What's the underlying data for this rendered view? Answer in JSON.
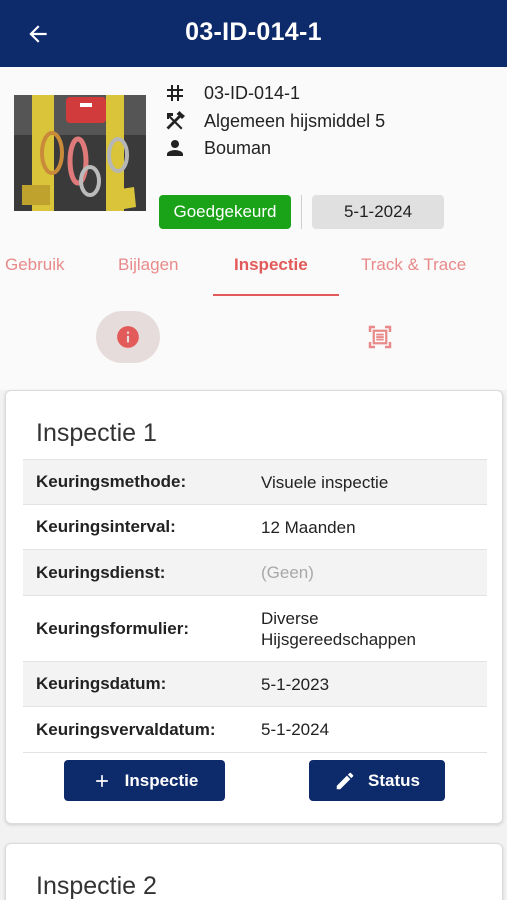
{
  "header": {
    "title": "03-ID-014-1",
    "back_icon": "arrow-left-icon"
  },
  "item": {
    "id": "03-ID-014-1",
    "description": "Algemeen hijsmiddel 5",
    "owner": "Bouman",
    "status": "Goedgekeurd",
    "date": "5-1-2024",
    "status_color": "#1aa319"
  },
  "tabs": [
    {
      "label": "Gebruik"
    },
    {
      "label": "Bijlagen"
    },
    {
      "label": "Inspectie"
    },
    {
      "label": "Track & Trace"
    }
  ],
  "active_tab": "Inspectie",
  "inspections": [
    {
      "title": "Inspectie 1",
      "fields": [
        {
          "label": "Keuringsmethode:",
          "value": "Visuele inspectie"
        },
        {
          "label": "Keuringsinterval:",
          "value": "12 Maanden"
        },
        {
          "label": "Keuringsdienst:",
          "value": "(Geen)"
        },
        {
          "label": "Keuringsformulier:",
          "value": "Diverse Hijsgereedschappen"
        },
        {
          "label": "Keuringsdatum:",
          "value": "5-1-2023"
        },
        {
          "label": "Keuringsvervaldatum:",
          "value": "5-1-2024"
        }
      ],
      "buttons": {
        "inspection": "Inspectie",
        "status": "Status"
      }
    },
    {
      "title": "Inspectie 2"
    }
  ],
  "colors": {
    "primary": "#0d2a6b",
    "accent": "#e25a5a",
    "success": "#1aa319"
  }
}
